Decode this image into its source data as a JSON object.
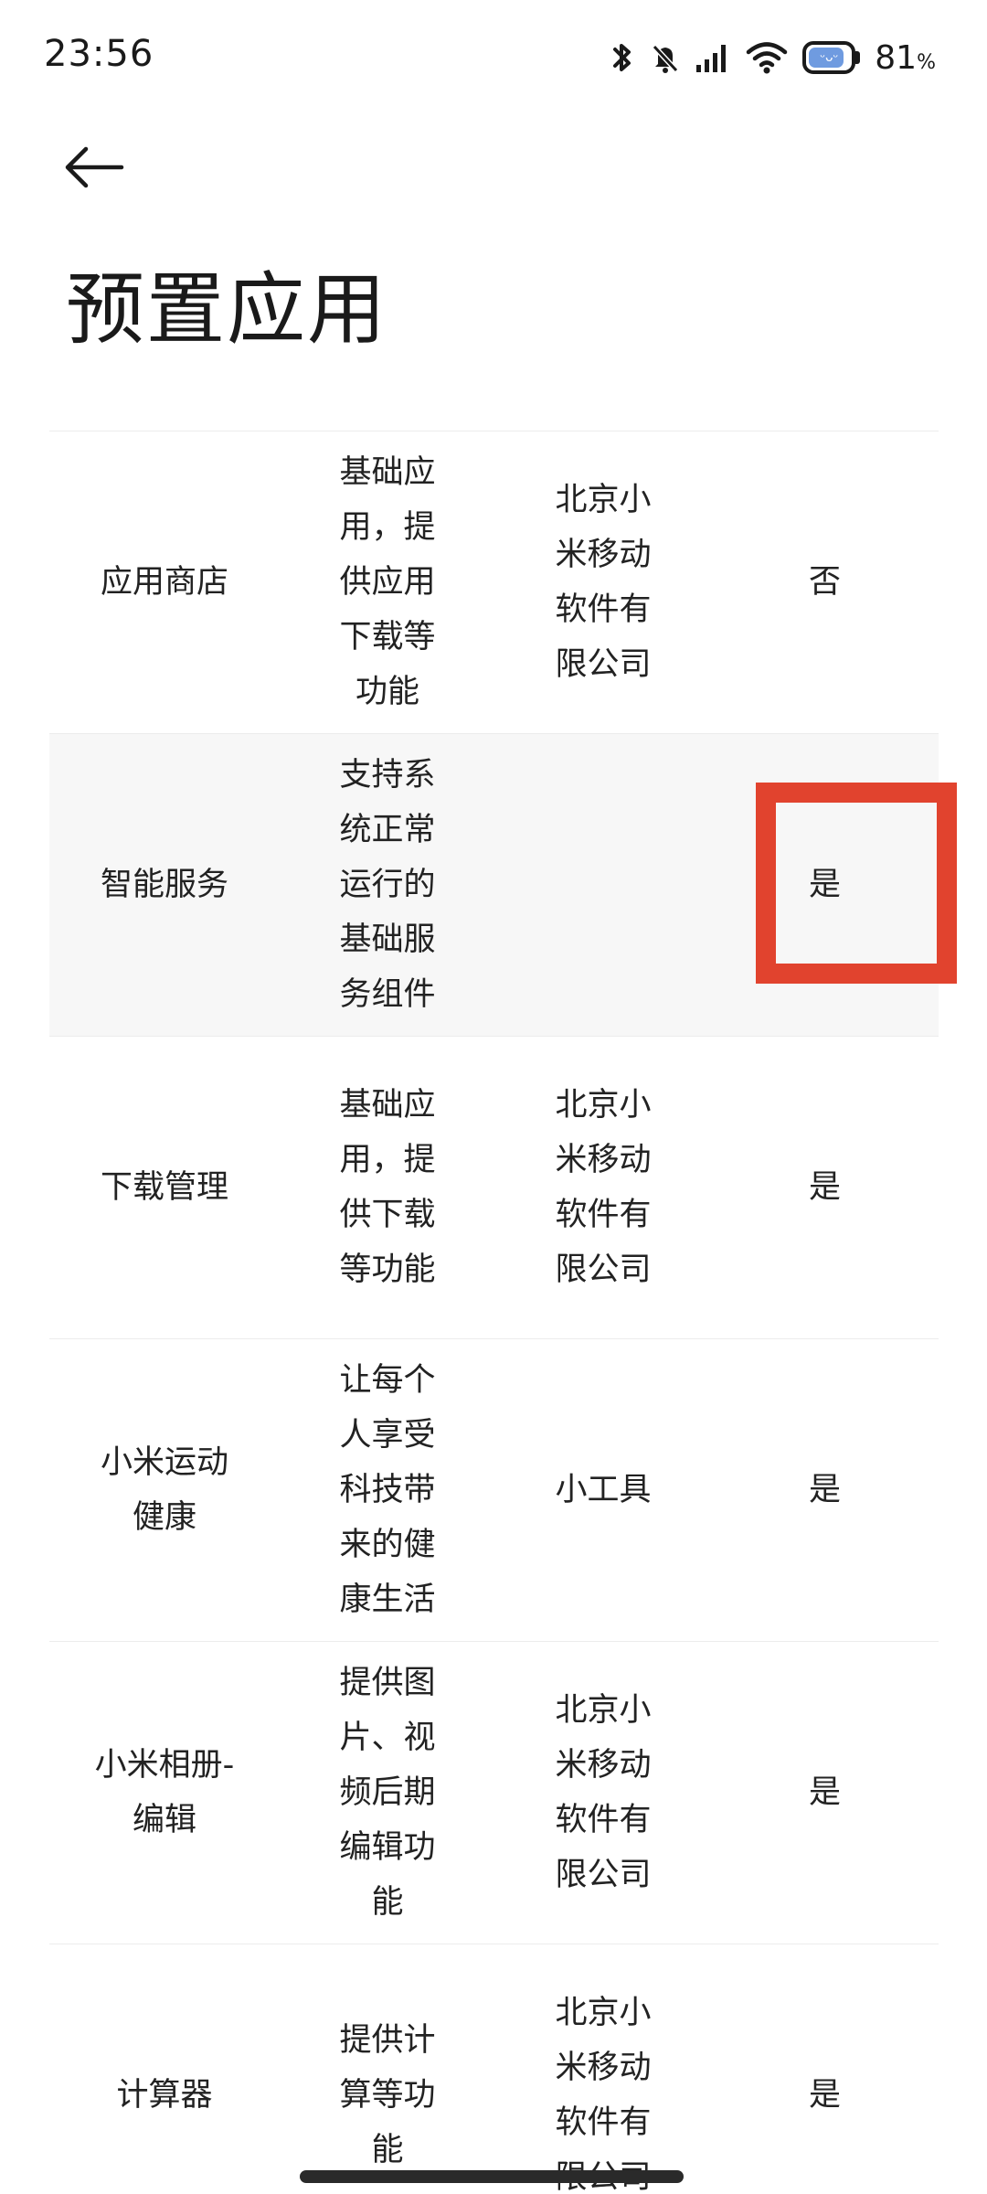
{
  "status_bar": {
    "time": "23:56",
    "battery_value": "81",
    "battery_unit": "%",
    "battery_color": "#6f9be0",
    "icons": [
      "bluetooth-icon",
      "mute-bell-icon",
      "signal-icon",
      "wifi-icon",
      "battery-icon"
    ]
  },
  "header": {
    "back_icon": "arrow-left-icon",
    "title": "预置应用"
  },
  "table": {
    "rows": [
      {
        "name": "应用商店",
        "desc": "基础应用，提供应用下载等功能",
        "developer": "北京小米移动软件有限公司",
        "value": "否",
        "shaded": false,
        "highlighted": false
      },
      {
        "name": "智能服务",
        "desc": "支持系统正常运行的基础服务组件",
        "developer": "",
        "value": "是",
        "shaded": true,
        "highlighted": true
      },
      {
        "name": "下载管理",
        "desc": "基础应用，提供下载等功能",
        "developer": "北京小米移动软件有限公司",
        "value": "是",
        "shaded": false,
        "highlighted": false
      },
      {
        "name": "小米运动健康",
        "desc": "让每个人享受科技带来的健康生活",
        "developer": "小工具",
        "value": "是",
        "shaded": false,
        "highlighted": false
      },
      {
        "name": "小米相册-编辑",
        "desc": "提供图片、视频后期编辑功能",
        "developer": "北京小米移动软件有限公司",
        "value": "是",
        "shaded": false,
        "highlighted": false
      },
      {
        "name": "计算器",
        "desc": "提供计算等功能",
        "developer": "北京小米移动软件有限公司",
        "value": "是",
        "shaded": false,
        "highlighted": false
      }
    ]
  },
  "colors": {
    "highlight": "#e1432e",
    "row_shade": "#f7f7f7"
  }
}
